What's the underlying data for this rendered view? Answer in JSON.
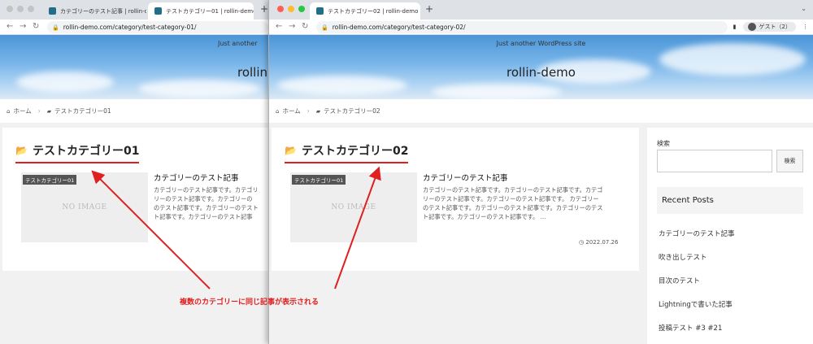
{
  "back_window": {
    "tabs": [
      {
        "title": "カテゴリーのテスト記事 | rollin-d"
      },
      {
        "title": "テストカテゴリー01 | rollin-demo"
      }
    ],
    "url": "rollin-demo.com/category/test-category-01/",
    "site": {
      "tagline": "Just another",
      "name": "rollin"
    },
    "breadcrumb": {
      "home": "ホーム",
      "current": "テストカテゴリー01"
    },
    "archive_title": "テストカテゴリー01",
    "post": {
      "badge": "テストカテゴリー01",
      "noimage": "NO IMAGE",
      "title": "カテゴリーのテスト記事",
      "excerpt_lines": [
        "カテゴリーのテスト記事です。カテゴリ",
        "リーのテスト記事です。カテゴリーの",
        "のテスト記事です。カテゴリーのテスト",
        "ト記事です。カテゴリーのテスト記事"
      ]
    }
  },
  "front_window": {
    "tabs": [
      {
        "title": "テストカテゴリー02 | rollin-demo"
      }
    ],
    "url": "rollin-demo.com/category/test-category-02/",
    "guest_label": "ゲスト（2）",
    "site": {
      "tagline": "Just another WordPress site",
      "name": "rollin-demo"
    },
    "breadcrumb": {
      "home": "ホーム",
      "current": "テストカテゴリー02"
    },
    "archive_title": "テストカテゴリー02",
    "post": {
      "badge": "テストカテゴリー01",
      "noimage": "NO IMAGE",
      "title": "カテゴリーのテスト記事",
      "excerpt_lines": [
        "カテゴリーのテスト記事です。カテゴリーのテスト記事です。カテゴ",
        "リーのテスト記事です。カテゴリーのテスト記事です。 カテゴリー",
        "のテスト記事です。カテゴリーのテスト記事です。カテゴリーのテス",
        "ト記事です。カテゴリーのテスト記事です。 ..."
      ],
      "date": "2022.07.26"
    },
    "sidebar": {
      "search_label": "検索",
      "search_button": "検索",
      "recent_heading": "Recent Posts",
      "recent_posts": [
        "カテゴリーのテスト記事",
        "吹き出しテスト",
        "目次のテスト",
        "Lightningで書いた記事",
        "投稿テスト #3 #21"
      ]
    }
  },
  "annotation": {
    "text": "複数のカテゴリーに同じ記事が表示される",
    "color": "#e02020"
  },
  "icons": {
    "home": "home-icon",
    "folder": "folder-open-icon",
    "clock": "clock-icon",
    "lock": "lock-icon"
  }
}
